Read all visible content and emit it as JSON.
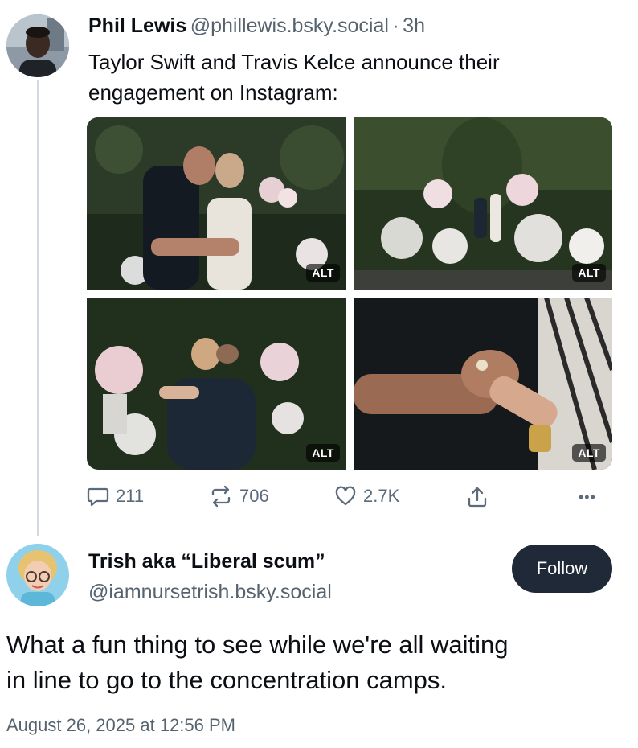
{
  "post": {
    "author_name": "Phil Lewis",
    "handle": "@phillewis.bsky.social",
    "separator": "·",
    "time": "3h",
    "text_line1": "Taylor Swift and Travis Kelce announce their",
    "text_line2": "engagement on Instagram:",
    "images": [
      {
        "alt_label": "ALT"
      },
      {
        "alt_label": "ALT"
      },
      {
        "alt_label": "ALT"
      },
      {
        "alt_label": "ALT"
      }
    ],
    "actions": {
      "reply_count": "211",
      "repost_count": "706",
      "like_count": "2.7K",
      "share_icon": "share-icon",
      "more_icon": "more-icon",
      "more_label": "•••"
    }
  },
  "reply": {
    "author_name": "Trish aka “Liberal scum”",
    "handle": "@iamnursetrish.bsky.social",
    "follow_label": "Follow",
    "text_line1": "What a fun thing to see while we're all waiting",
    "text_line2": "in line to go to the concentration camps.",
    "timestamp": "August 26, 2025 at 12:56 PM"
  },
  "colors": {
    "follow_bg": "#1f2937",
    "muted": "#56636f",
    "icon": "#5b6b7b"
  }
}
